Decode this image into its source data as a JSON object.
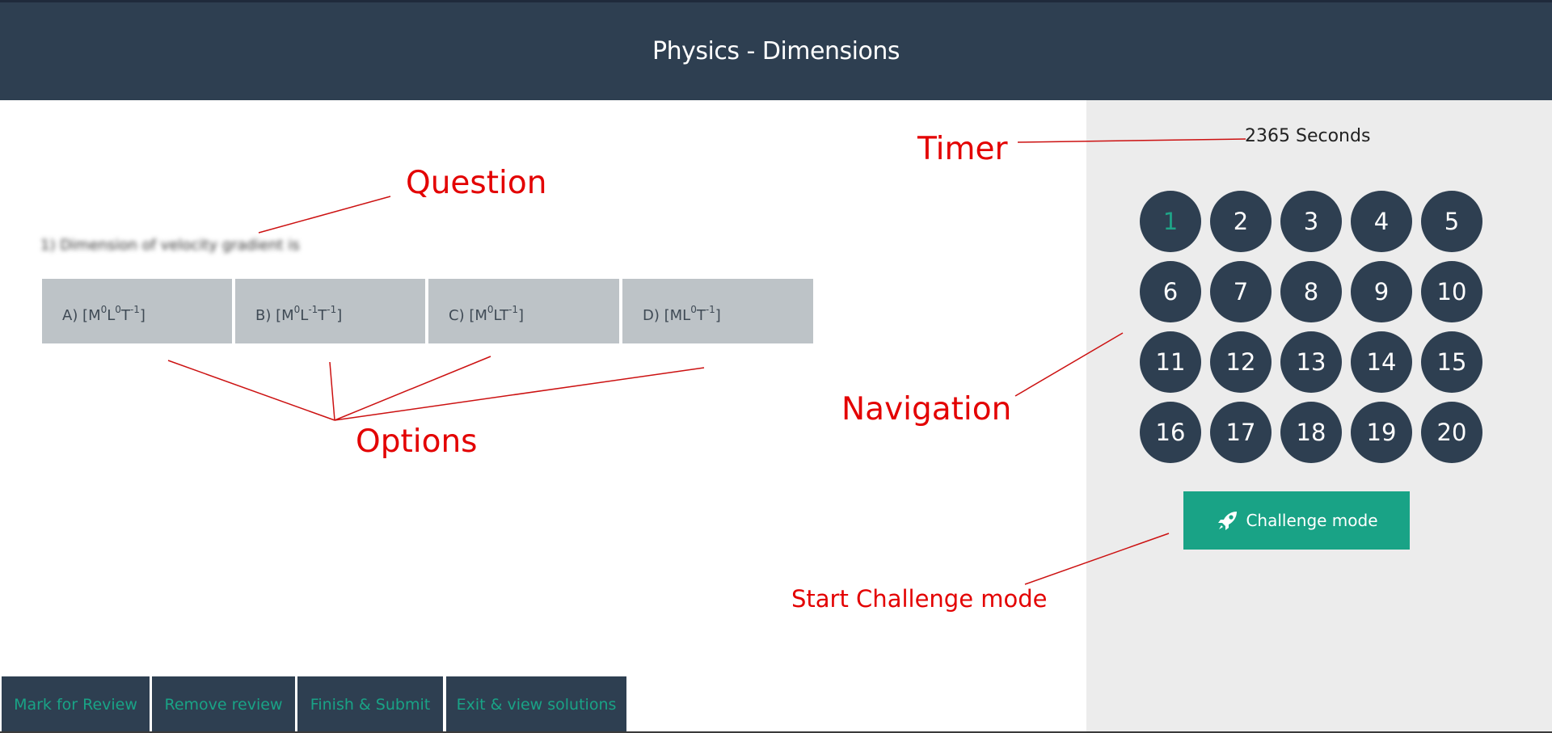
{
  "header": {
    "title": "Physics - Dimensions"
  },
  "timer": {
    "text": "2365 Seconds"
  },
  "question": {
    "text": "1) Dimension of velocity gradient is"
  },
  "options": [
    {
      "prefix": "A) [M",
      "parts": [
        "0",
        "L",
        "0",
        "T",
        "-1",
        "]"
      ]
    },
    {
      "prefix": "B) [M",
      "parts": [
        "0",
        "L",
        "-1",
        "T",
        "-1",
        "]"
      ]
    },
    {
      "prefix": "C) [M",
      "parts": [
        "0",
        "LT",
        "-1",
        "]"
      ]
    },
    {
      "prefix": "D) [ML",
      "parts": [
        "0",
        "T",
        "-1",
        "]"
      ]
    }
  ],
  "navigation": {
    "current": "1",
    "numbers": [
      "1",
      "2",
      "3",
      "4",
      "5",
      "6",
      "7",
      "8",
      "9",
      "10",
      "11",
      "12",
      "13",
      "14",
      "15",
      "16",
      "17",
      "18",
      "19",
      "20"
    ]
  },
  "challenge": {
    "label": "Challenge mode",
    "icon": "rocket-icon"
  },
  "bottom_buttons": [
    "Mark for Review",
    "Remove review",
    "Finish & Submit",
    "Exit & view solutions"
  ],
  "annotations": {
    "question": "Question",
    "options": "Options",
    "timer": "Timer",
    "navigation": "Navigation",
    "challenge": "Start Challenge mode"
  },
  "colors": {
    "header_bg": "#2e3f51",
    "sidebar_bg": "#ececec",
    "accent": "#19a386",
    "option_bg": "#bdc3c7",
    "annotation": "#e30000"
  }
}
